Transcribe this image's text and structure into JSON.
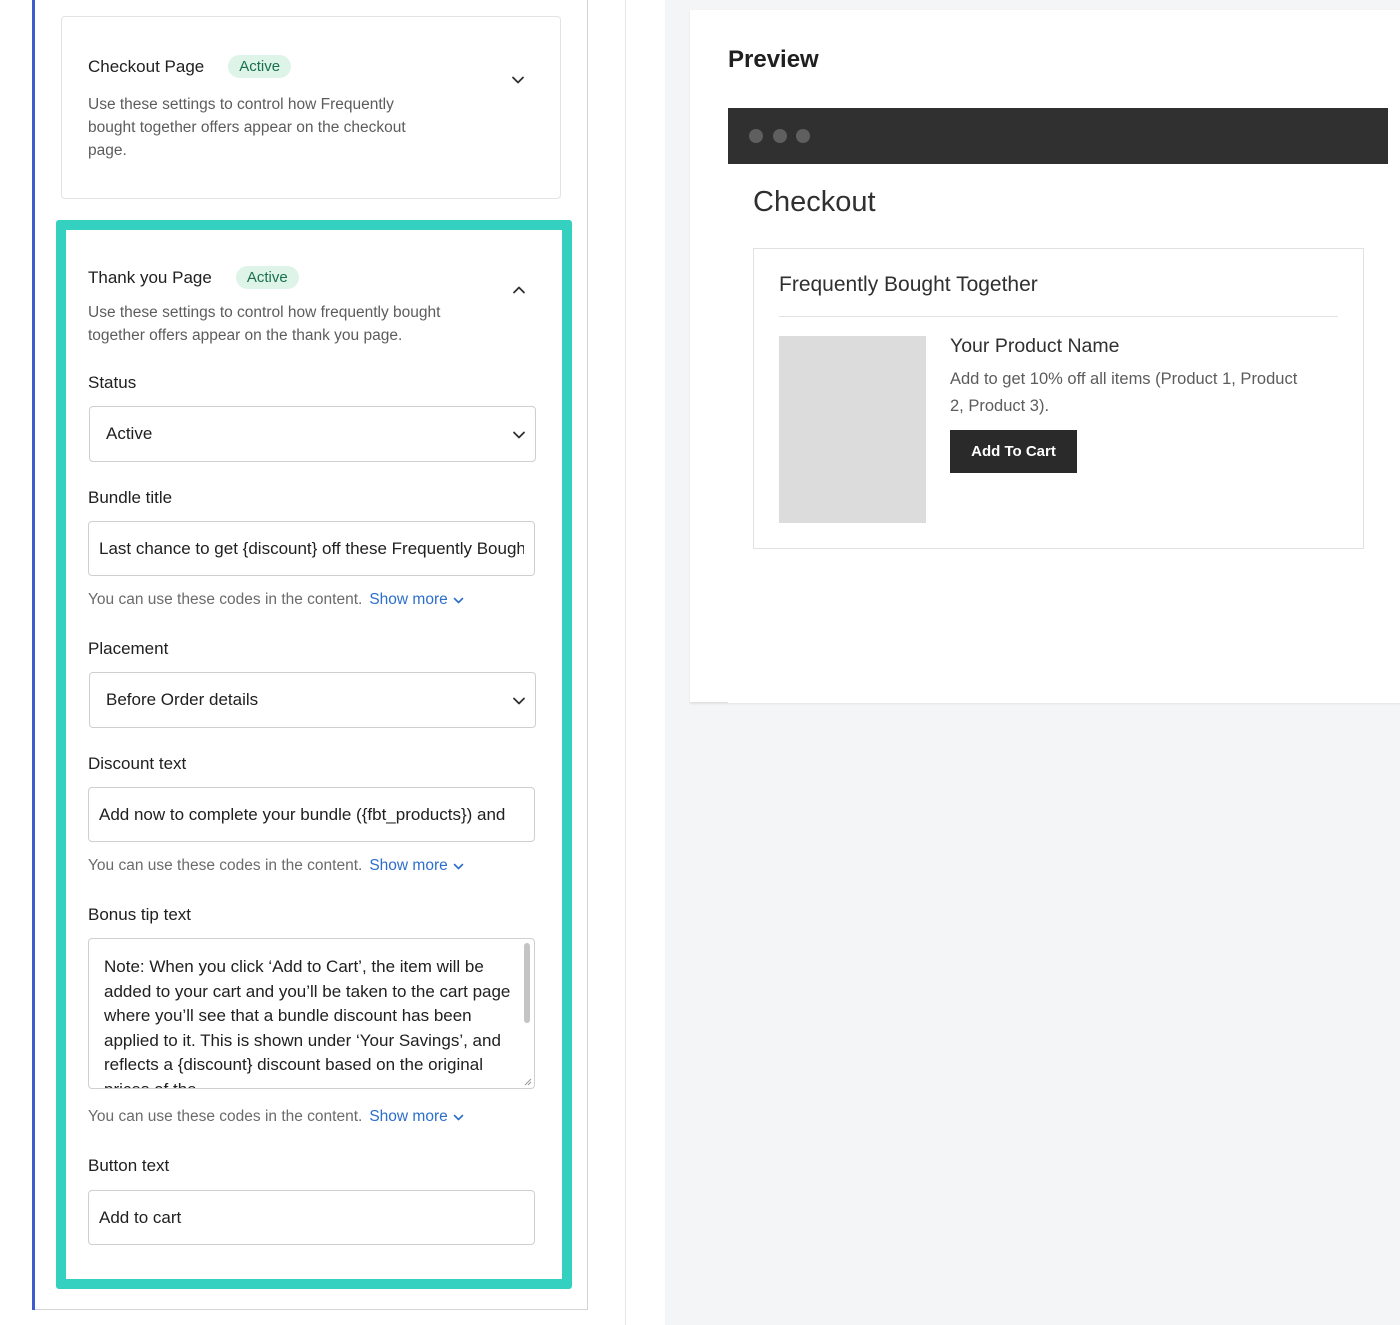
{
  "checkout_card": {
    "title": "Checkout Page",
    "badge": "Active",
    "desc_lines": [
      "Use these settings to control how Frequently",
      "bought together offers appear on the checkout",
      "page."
    ]
  },
  "thanks_card": {
    "title": "Thank you Page",
    "badge": "Active",
    "desc_lines": [
      "Use these settings to control how frequently bought",
      "together offers appear on the thank you page."
    ],
    "status": {
      "label": "Status",
      "value": "Active"
    },
    "bundle_title": {
      "label": "Bundle title",
      "value": "Last chance to get {discount} off these Frequently Bought Together"
    },
    "placement": {
      "label": "Placement",
      "value": "Before Order details"
    },
    "discount_text": {
      "label": "Discount text",
      "value": "Add now to complete your bundle ({fbt_products}) and"
    },
    "bonus_tip": {
      "label": "Bonus tip text",
      "value": "Note: When you click ‘Add to Cart’, the item will be added to your cart and you’ll be taken to the cart page where you’ll see that a bundle discount has been applied to it. This is shown under ‘Your Savings’, and reflects a {discount} discount based on the original prices of the"
    },
    "button_text": {
      "label": "Button text",
      "value": "Add to cart"
    },
    "helper_text": "You can use these codes in the content.",
    "show_more": "Show more"
  },
  "preview": {
    "title": "Preview",
    "page_heading": "Checkout",
    "box_title": "Frequently Bought Together",
    "product_name": "Your Product Name",
    "product_desc_lines": [
      "Add to get 10% off all items (Product 1, Product",
      "2, Product 3)."
    ],
    "button": "Add To Cart"
  },
  "colors": {
    "highlight": "#34d0c0",
    "left_accent": "#3f5bd0",
    "badge_bg": "#def4e9",
    "badge_text": "#19714c",
    "link": "#2c6ecb",
    "browser_bar": "#303030"
  }
}
